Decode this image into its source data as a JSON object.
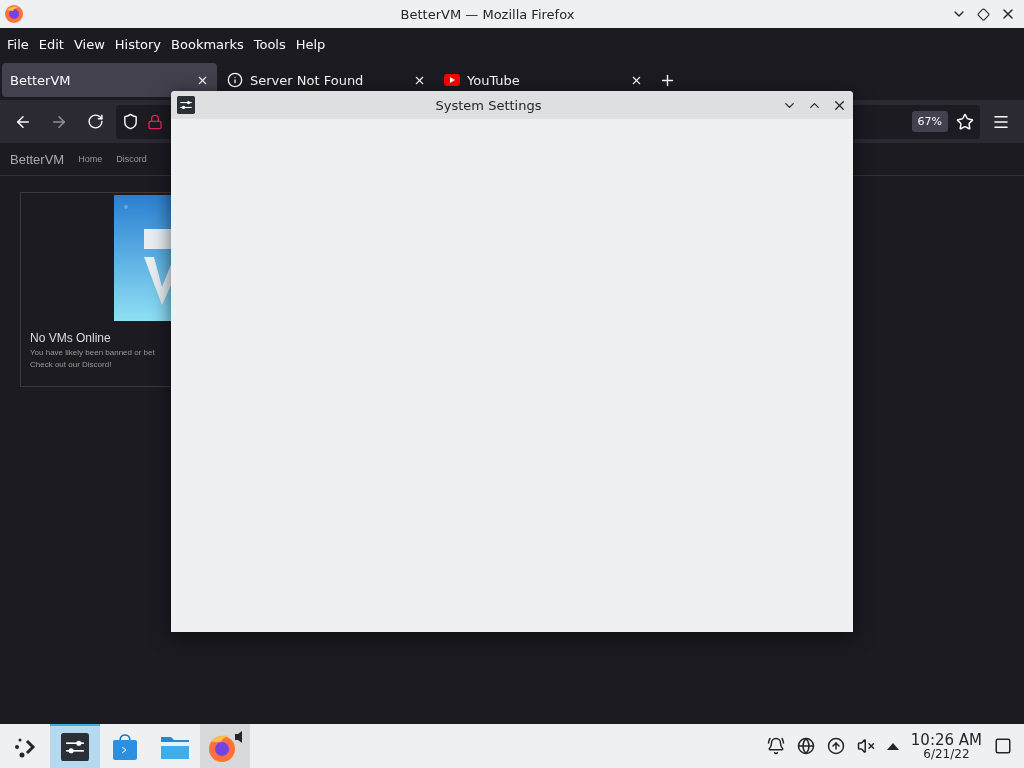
{
  "window": {
    "title": "BetterVM — Mozilla Firefox"
  },
  "menu": [
    "File",
    "Edit",
    "View",
    "History",
    "Bookmarks",
    "Tools",
    "Help"
  ],
  "tabs": [
    {
      "label": "BetterVM",
      "selected": true,
      "kind": "plain"
    },
    {
      "label": "Server Not Found",
      "selected": false,
      "kind": "info"
    },
    {
      "label": "YouTube",
      "selected": false,
      "kind": "video"
    }
  ],
  "toolbar": {
    "zoom": "67%"
  },
  "site_nav": {
    "brand": "BetterVM",
    "links": [
      "Home",
      "Discord"
    ]
  },
  "card": {
    "title": "No VMs Online",
    "lines": [
      "You have likely been banned or bet",
      "Check out our Discord!"
    ]
  },
  "dialog": {
    "title": "System Settings"
  },
  "taskbar": {
    "apps": [
      {
        "kind": "launcher",
        "selected": false,
        "running": false
      },
      {
        "kind": "settings",
        "selected": true,
        "running": true
      },
      {
        "kind": "store",
        "selected": false,
        "running": false
      },
      {
        "kind": "files",
        "selected": false,
        "running": false
      },
      {
        "kind": "firefox",
        "selected": false,
        "running": true
      }
    ],
    "time": "10:26 AM",
    "date": "6/21/22"
  }
}
